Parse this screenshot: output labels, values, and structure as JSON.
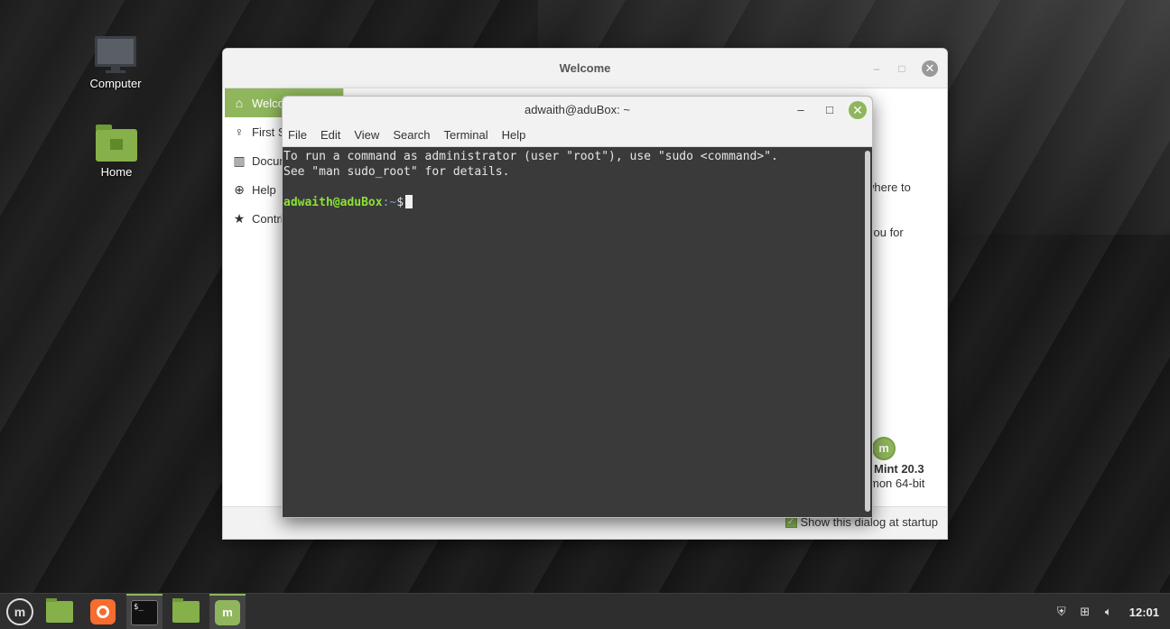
{
  "desktop": {
    "icons": [
      {
        "label": "Computer"
      },
      {
        "label": "Home"
      }
    ]
  },
  "welcome": {
    "title": "Welcome",
    "sidebar": [
      {
        "label": "Welcome",
        "icon": "home-icon"
      },
      {
        "label": "First Steps",
        "icon": "lightbulb-icon"
      },
      {
        "label": "Documentation",
        "icon": "book-icon"
      },
      {
        "label": "Help",
        "icon": "lifebuoy-icon"
      },
      {
        "label": "Contribute",
        "icon": "star-icon"
      }
    ],
    "partial_text_1": "where to",
    "partial_text_2": "you for",
    "version": "Mint 20.3",
    "edition": "mon 64-bit",
    "show_startup_label": "Show this dialog at startup",
    "show_startup_checked": true
  },
  "terminal": {
    "title": "adwaith@aduBox: ~",
    "menu": [
      "File",
      "Edit",
      "View",
      "Search",
      "Terminal",
      "Help"
    ],
    "line1": "To run a command as administrator (user \"root\"), use \"sudo <command>\".",
    "line2": "See \"man sudo_root\" for details.",
    "prompt_user": "adwaith@aduBox",
    "prompt_path": ":~",
    "prompt_symbol": "$"
  },
  "taskbar": {
    "clock": "12:01",
    "menu_glyph": "m",
    "mint_glyph": "m",
    "terminal_glyph": "$_"
  },
  "colors": {
    "accent": "#8fb65c",
    "terminal_bg": "#3a3a3a"
  }
}
